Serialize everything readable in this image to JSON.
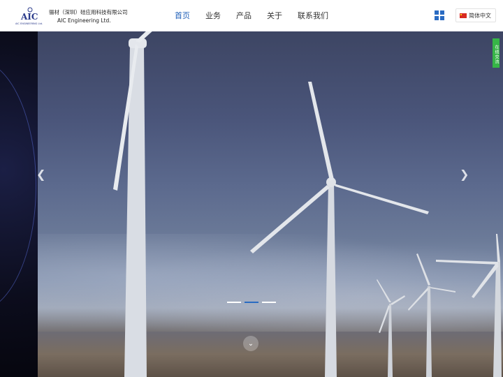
{
  "brand": {
    "name_cn": "骊材（深圳）硅应用科技有限公司",
    "name_en": "AIC  Engineering Ltd.",
    "logo_text": "AIC",
    "logo_sub": "AIC ENGINEERING Ltd."
  },
  "nav": {
    "items": [
      {
        "label": "首页",
        "active": true
      },
      {
        "label": "业务",
        "active": false
      },
      {
        "label": "产品",
        "active": false
      },
      {
        "label": "关于",
        "active": false
      },
      {
        "label": "联系我们",
        "active": false
      }
    ]
  },
  "language": {
    "label": "简体中文",
    "flag": "china-flag-icon"
  },
  "chat": {
    "label": "在线交流"
  },
  "hero": {
    "prev_icon": "chevron-left-icon",
    "next_icon": "chevron-right-icon",
    "scroll_icon": "chevron-down-icon",
    "slides": [
      {
        "active": false
      },
      {
        "active": true
      },
      {
        "active": false
      }
    ]
  },
  "colors": {
    "accent": "#2a6bc2",
    "chat_green": "#36b547"
  }
}
